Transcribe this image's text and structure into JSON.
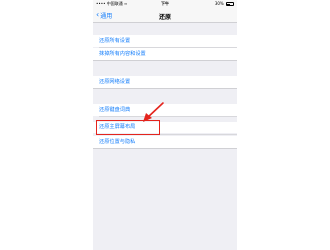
{
  "status_bar": {
    "carrier": "•••• 中国联通",
    "wifi": "≈",
    "time": "下午",
    "battery": "30%"
  },
  "nav": {
    "back_label": "通用",
    "title": "还原"
  },
  "groups": [
    {
      "items": [
        "还原所有设置",
        "抹掉所有内容和设置"
      ]
    },
    {
      "items": [
        "还原网络设置"
      ]
    },
    {
      "items": [
        "还原键盘词典",
        "还原主屏幕布局",
        "还原位置与隐私"
      ]
    }
  ],
  "annotation": {
    "highlighted_item": "还原主屏幕布局",
    "color": "#e4241d"
  },
  "colors": {
    "accent": "#147efb",
    "background": "#efeff4"
  }
}
